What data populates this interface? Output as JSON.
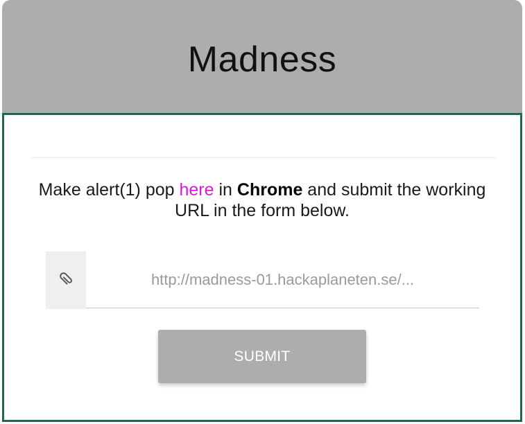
{
  "header": {
    "title": "Madness"
  },
  "instructions": {
    "prefix": "Make alert(1) pop ",
    "link_text": "here",
    "middle": " in ",
    "browser": "Chrome",
    "suffix": " and submit the working URL in the form below."
  },
  "form": {
    "addon_icon": "paperclip-icon",
    "url_placeholder": "http://madness-01.hackaplaneten.se/...",
    "url_value": "",
    "submit_label": "SUBMIT"
  },
  "colors": {
    "header_bg": "#adadad",
    "body_border": "#1f6653",
    "link": "#d61bd6",
    "button_bg": "#adadad"
  }
}
